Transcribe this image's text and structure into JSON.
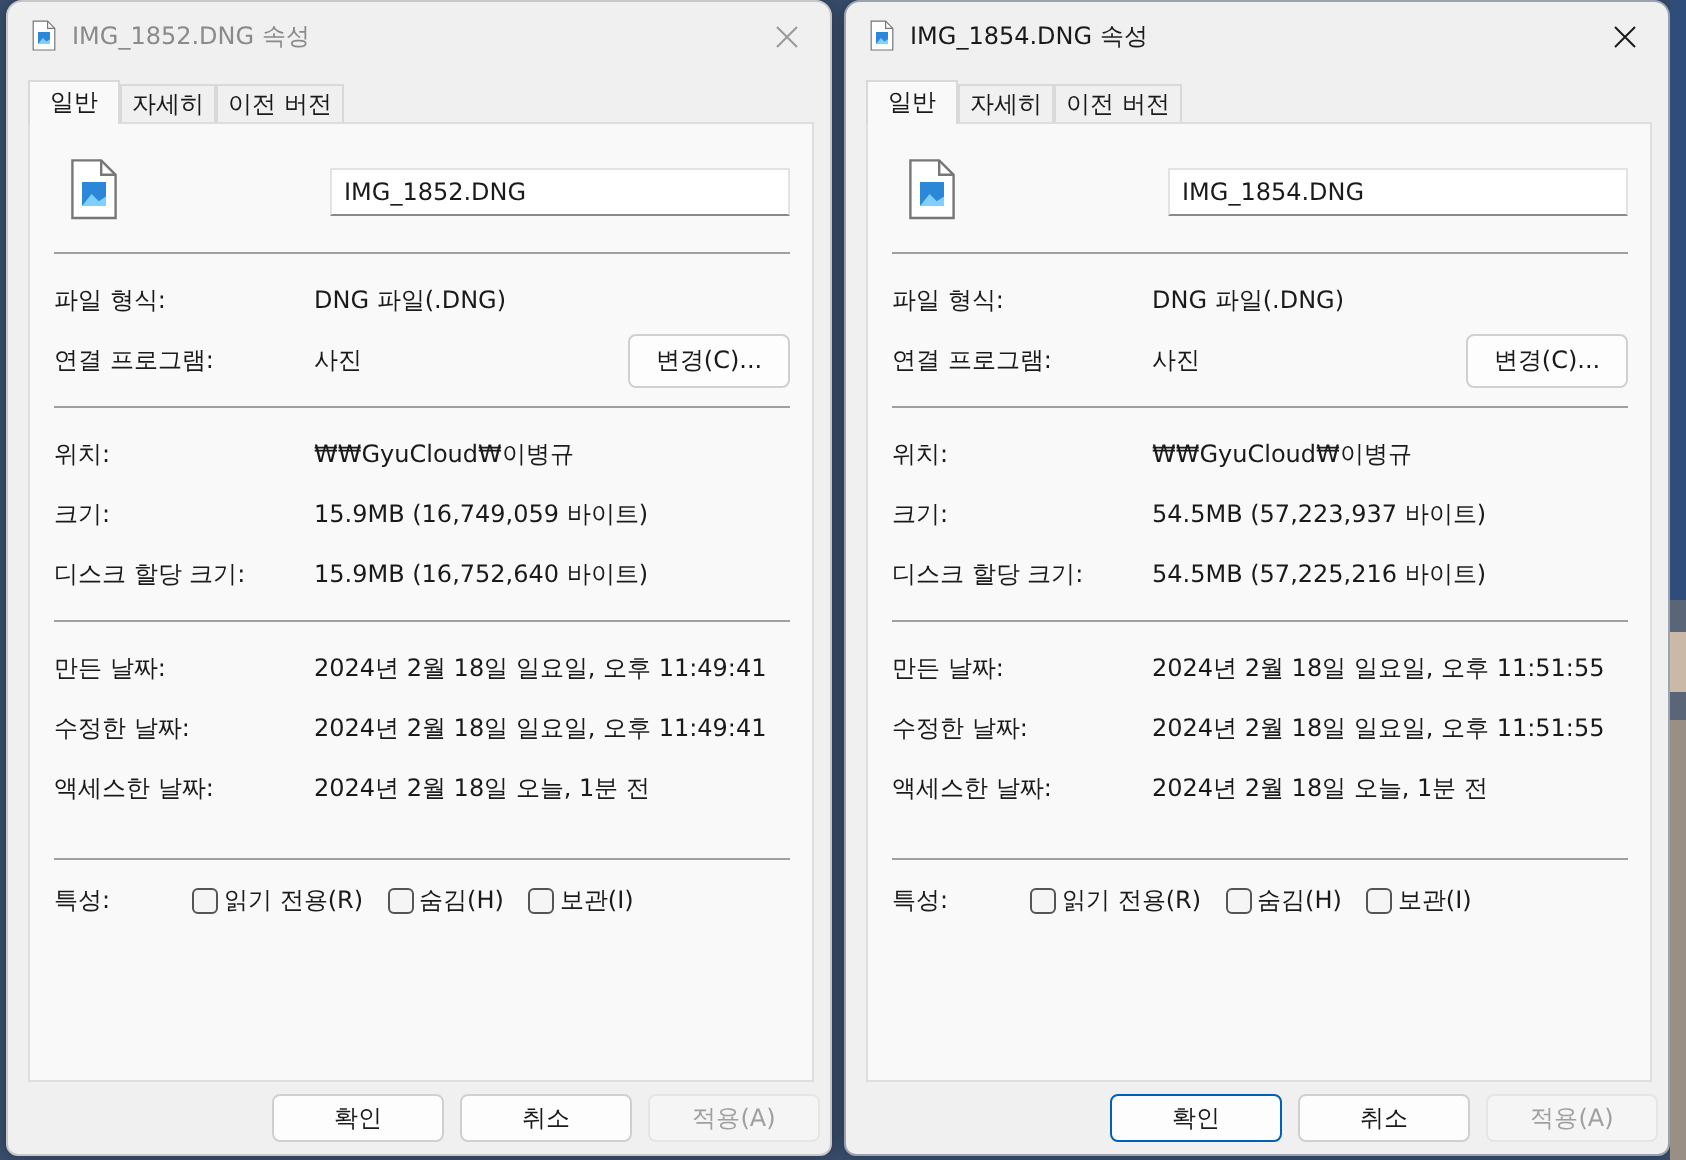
{
  "dialogs": [
    {
      "title": "IMG_1852.DNG 속성",
      "active": false,
      "tabs": [
        {
          "label": "일반",
          "selected": true
        },
        {
          "label": "자세히",
          "selected": false
        },
        {
          "label": "이전 버전",
          "selected": false
        }
      ],
      "filename": "IMG_1852.DNG",
      "sections": [
        [
          {
            "label": "파일 형식:",
            "value": "DNG 파일(.DNG)"
          },
          {
            "label": "연결 프로그램:",
            "value": "사진",
            "button": "변경(C)..."
          }
        ],
        [
          {
            "label": "위치:",
            "value": "₩₩GyuCloud₩이병규"
          },
          {
            "label": "크기:",
            "value": "15.9MB (16,749,059 바이트)"
          },
          {
            "label": "디스크 할당 크기:",
            "value": "15.9MB (16,752,640 바이트)"
          }
        ],
        [
          {
            "label": "만든 날짜:",
            "value": "2024년 2월 18일 일요일, 오후 11:49:41"
          },
          {
            "label": "수정한 날짜:",
            "value": "2024년 2월 18일 일요일, 오후 11:49:41"
          },
          {
            "label": "액세스한 날짜:",
            "value": "2024년 2월 18일 오늘, 1분 전"
          }
        ]
      ],
      "attributes_label": "특성:",
      "attributes": [
        {
          "label": "읽기 전용(R)",
          "checked": false
        },
        {
          "label": "숨김(H)",
          "checked": false
        },
        {
          "label": "보관(I)",
          "checked": false
        }
      ],
      "buttons": [
        {
          "label": "확인",
          "disabled": false
        },
        {
          "label": "취소",
          "disabled": false
        },
        {
          "label": "적용(A)",
          "disabled": true
        }
      ]
    },
    {
      "title": "IMG_1854.DNG 속성",
      "active": true,
      "tabs": [
        {
          "label": "일반",
          "selected": true
        },
        {
          "label": "자세히",
          "selected": false
        },
        {
          "label": "이전 버전",
          "selected": false
        }
      ],
      "filename": "IMG_1854.DNG",
      "sections": [
        [
          {
            "label": "파일 형식:",
            "value": "DNG 파일(.DNG)"
          },
          {
            "label": "연결 프로그램:",
            "value": "사진",
            "button": "변경(C)..."
          }
        ],
        [
          {
            "label": "위치:",
            "value": "₩₩GyuCloud₩이병규"
          },
          {
            "label": "크기:",
            "value": "54.5MB (57,223,937 바이트)"
          },
          {
            "label": "디스크 할당 크기:",
            "value": "54.5MB (57,225,216 바이트)"
          }
        ],
        [
          {
            "label": "만든 날짜:",
            "value": "2024년 2월 18일 일요일, 오후 11:51:55"
          },
          {
            "label": "수정한 날짜:",
            "value": "2024년 2월 18일 일요일, 오후 11:51:55"
          },
          {
            "label": "액세스한 날짜:",
            "value": "2024년 2월 18일 오늘, 1분 전"
          }
        ]
      ],
      "attributes_label": "특성:",
      "attributes": [
        {
          "label": "읽기 전용(R)",
          "checked": false
        },
        {
          "label": "숨김(H)",
          "checked": false
        },
        {
          "label": "보관(I)",
          "checked": false
        }
      ],
      "buttons": [
        {
          "label": "확인",
          "default": true,
          "disabled": false
        },
        {
          "label": "취소",
          "default": false,
          "disabled": false
        },
        {
          "label": "적용(A)",
          "default": false,
          "disabled": true
        }
      ]
    }
  ]
}
